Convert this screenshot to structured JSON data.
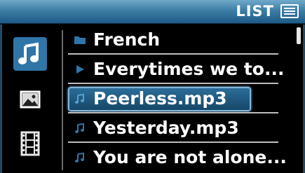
{
  "header": {
    "title": "LIST",
    "icon": "list-icon"
  },
  "categories": [
    {
      "name": "music",
      "icon": "music-note-icon",
      "selected": true
    },
    {
      "name": "photo",
      "icon": "picture-icon",
      "selected": false
    },
    {
      "name": "video",
      "icon": "film-icon",
      "selected": false
    }
  ],
  "list": {
    "items": [
      {
        "label": "French",
        "icon": "folder-icon",
        "selected": false
      },
      {
        "label": "Everytimes we to...",
        "icon": "play-icon",
        "selected": false
      },
      {
        "label": "Peerless.mp3",
        "icon": "music-note-icon",
        "selected": true
      },
      {
        "label": "Yesterday.mp3",
        "icon": "music-note-icon",
        "selected": false
      },
      {
        "label": "You are not alone...",
        "icon": "music-note-icon",
        "selected": false
      }
    ]
  },
  "colors": {
    "accent": "#2f75a8",
    "header_top": "#6fa9c8",
    "header_bottom": "#1d5a86",
    "text": "#ffffff",
    "icon_blue": "#2f75a8"
  }
}
